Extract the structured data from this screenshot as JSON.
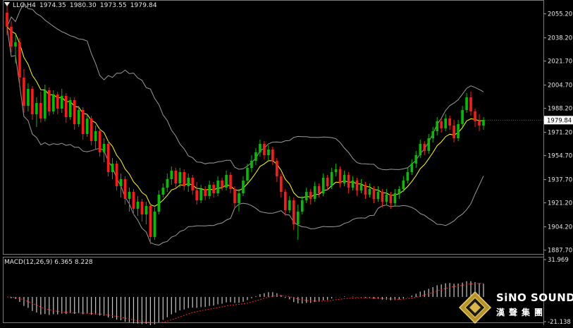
{
  "header": {
    "symbol": "LLG,H4",
    "open": "1974.35",
    "high": "1980.30",
    "low": "1973.55",
    "close": "1979.84"
  },
  "macd_header": {
    "label": "MACD(12,26,9)",
    "main": "6.365",
    "signal": "8.228"
  },
  "logo": {
    "brand": "SiNO SOUND",
    "cjk": "漢聲集團"
  },
  "colors": {
    "background": "#000000",
    "bull": "#00c000",
    "bear": "#ff1a1a",
    "ma": "#ffff00",
    "bands": "#9a9a9a",
    "macd_hist": "#c8c8c8",
    "macd_signal": "#ff2020"
  },
  "chart_data": [
    {
      "type": "candlestick",
      "symbol": "LLG",
      "timeframe": "H4",
      "y_ticks": [
        "2055.20",
        "2038.20",
        "2021.70",
        "2004.70",
        "1988.20",
        "1971.20",
        "1954.70",
        "1937.70",
        "1921.20",
        "1904.20",
        "1887.70"
      ],
      "ylim": [
        1886,
        2064
      ],
      "current_price": "1979.84",
      "indicators": [
        "Bollinger Bands",
        "Moving Average"
      ],
      "candles": [
        [
          2056,
          2062,
          2040,
          2046
        ],
        [
          2046,
          2050,
          2028,
          2032
        ],
        [
          2032,
          2040,
          2020,
          2035
        ],
        [
          2035,
          2038,
          2005,
          2010
        ],
        [
          2010,
          2016,
          1985,
          1990
        ],
        [
          1990,
          2006,
          1986,
          2002
        ],
        [
          2002,
          2004,
          1980,
          1984
        ],
        [
          1984,
          1996,
          1975,
          1992
        ],
        [
          1992,
          2000,
          1978,
          1981
        ],
        [
          1981,
          2005,
          1979,
          2001
        ],
        [
          2001,
          2003,
          1983,
          1986
        ],
        [
          1986,
          2001,
          1984,
          1998
        ],
        [
          1998,
          2000,
          1984,
          1988
        ],
        [
          1988,
          2002,
          1985,
          1997
        ],
        [
          1997,
          1999,
          1978,
          1982
        ],
        [
          1982,
          1996,
          1980,
          1994
        ],
        [
          1994,
          1996,
          1973,
          1977
        ],
        [
          1977,
          1990,
          1975,
          1987
        ],
        [
          1987,
          1989,
          1966,
          1970
        ],
        [
          1970,
          1984,
          1968,
          1981
        ],
        [
          1981,
          1983,
          1962,
          1965
        ],
        [
          1965,
          1976,
          1959,
          1972
        ],
        [
          1972,
          1974,
          1954,
          1957
        ],
        [
          1957,
          1967,
          1950,
          1963
        ],
        [
          1963,
          1965,
          1940,
          1943
        ],
        [
          1943,
          1953,
          1938,
          1949
        ],
        [
          1949,
          1951,
          1930,
          1933
        ],
        [
          1933,
          1942,
          1925,
          1938
        ],
        [
          1938,
          1940,
          1920,
          1924
        ],
        [
          1924,
          1932,
          1915,
          1929
        ],
        [
          1929,
          1931,
          1913,
          1917
        ],
        [
          1917,
          1926,
          1912,
          1922
        ],
        [
          1922,
          1924,
          1908,
          1913
        ],
        [
          1913,
          1922,
          1906,
          1919
        ],
        [
          1919,
          1921,
          1892,
          1897
        ],
        [
          1897,
          1918,
          1895,
          1915
        ],
        [
          1915,
          1930,
          1913,
          1927
        ],
        [
          1927,
          1935,
          1925,
          1932
        ],
        [
          1932,
          1942,
          1929,
          1938
        ],
        [
          1938,
          1947,
          1934,
          1944
        ],
        [
          1944,
          1946,
          1932,
          1935
        ],
        [
          1935,
          1946,
          1932,
          1943
        ],
        [
          1943,
          1945,
          1930,
          1933
        ],
        [
          1933,
          1942,
          1929,
          1939
        ],
        [
          1939,
          1941,
          1927,
          1930
        ],
        [
          1930,
          1936,
          1920,
          1923
        ],
        [
          1923,
          1934,
          1921,
          1931
        ],
        [
          1931,
          1933,
          1923,
          1926
        ],
        [
          1926,
          1937,
          1924,
          1934
        ],
        [
          1934,
          1936,
          1925,
          1928
        ],
        [
          1928,
          1940,
          1926,
          1937
        ],
        [
          1937,
          1939,
          1930,
          1932
        ],
        [
          1932,
          1944,
          1930,
          1941
        ],
        [
          1941,
          1943,
          1928,
          1931
        ],
        [
          1931,
          1933,
          1918,
          1921
        ],
        [
          1921,
          1931,
          1915,
          1928
        ],
        [
          1928,
          1940,
          1926,
          1937
        ],
        [
          1937,
          1949,
          1935,
          1946
        ],
        [
          1946,
          1955,
          1943,
          1951
        ],
        [
          1951,
          1960,
          1948,
          1957
        ],
        [
          1957,
          1966,
          1954,
          1963
        ],
        [
          1963,
          1965,
          1952,
          1955
        ],
        [
          1955,
          1962,
          1951,
          1959
        ],
        [
          1959,
          1961,
          1948,
          1951
        ],
        [
          1951,
          1953,
          1936,
          1940
        ],
        [
          1940,
          1942,
          1925,
          1929
        ],
        [
          1929,
          1931,
          1912,
          1916
        ],
        [
          1916,
          1926,
          1914,
          1923
        ],
        [
          1923,
          1925,
          1902,
          1906
        ],
        [
          1906,
          1920,
          1895,
          1915
        ],
        [
          1915,
          1926,
          1913,
          1923
        ],
        [
          1923,
          1932,
          1921,
          1929
        ],
        [
          1929,
          1931,
          1920,
          1924
        ],
        [
          1924,
          1936,
          1922,
          1933
        ],
        [
          1933,
          1935,
          1925,
          1928
        ],
        [
          1928,
          1942,
          1926,
          1939
        ],
        [
          1939,
          1941,
          1930,
          1933
        ],
        [
          1933,
          1946,
          1931,
          1943
        ],
        [
          1943,
          1949,
          1940,
          1945
        ],
        [
          1945,
          1947,
          1932,
          1935
        ],
        [
          1935,
          1944,
          1933,
          1941
        ],
        [
          1941,
          1943,
          1928,
          1932
        ],
        [
          1932,
          1940,
          1930,
          1937
        ],
        [
          1937,
          1939,
          1926,
          1930
        ],
        [
          1930,
          1938,
          1928,
          1934
        ],
        [
          1934,
          1936,
          1924,
          1927
        ],
        [
          1927,
          1935,
          1925,
          1931
        ],
        [
          1931,
          1933,
          1921,
          1924
        ],
        [
          1924,
          1933,
          1922,
          1929
        ],
        [
          1929,
          1931,
          1918,
          1922
        ],
        [
          1922,
          1931,
          1920,
          1927
        ],
        [
          1927,
          1929,
          1917,
          1921
        ],
        [
          1921,
          1931,
          1919,
          1928
        ],
        [
          1928,
          1933,
          1924,
          1931
        ],
        [
          1931,
          1940,
          1929,
          1937
        ],
        [
          1937,
          1946,
          1935,
          1943
        ],
        [
          1943,
          1952,
          1941,
          1949
        ],
        [
          1949,
          1958,
          1946,
          1955
        ],
        [
          1955,
          1966,
          1953,
          1963
        ],
        [
          1963,
          1965,
          1955,
          1958
        ],
        [
          1958,
          1970,
          1956,
          1967
        ],
        [
          1967,
          1975,
          1964,
          1972
        ],
        [
          1972,
          1982,
          1969,
          1979
        ],
        [
          1979,
          1981,
          1971,
          1974
        ],
        [
          1974,
          1984,
          1972,
          1981
        ],
        [
          1981,
          1983,
          1973,
          1976
        ],
        [
          1976,
          1980,
          1964,
          1967
        ],
        [
          1967,
          1980,
          1965,
          1977
        ],
        [
          1977,
          1990,
          1975,
          1987
        ],
        [
          1987,
          1999,
          1985,
          1996
        ],
        [
          1996,
          2000,
          1983,
          1986
        ],
        [
          1986,
          1988,
          1975,
          1979
        ],
        [
          1979,
          1984,
          1972,
          1976
        ],
        [
          1976,
          1982,
          1973,
          1980
        ]
      ]
    },
    {
      "type": "bar",
      "name": "MACD(12,26,9)",
      "y_ticks": [
        "31.969",
        "-21.138"
      ],
      "ylim": [
        -21.138,
        31.969
      ],
      "main_value": 6.365,
      "signal_value": 8.228
    }
  ]
}
